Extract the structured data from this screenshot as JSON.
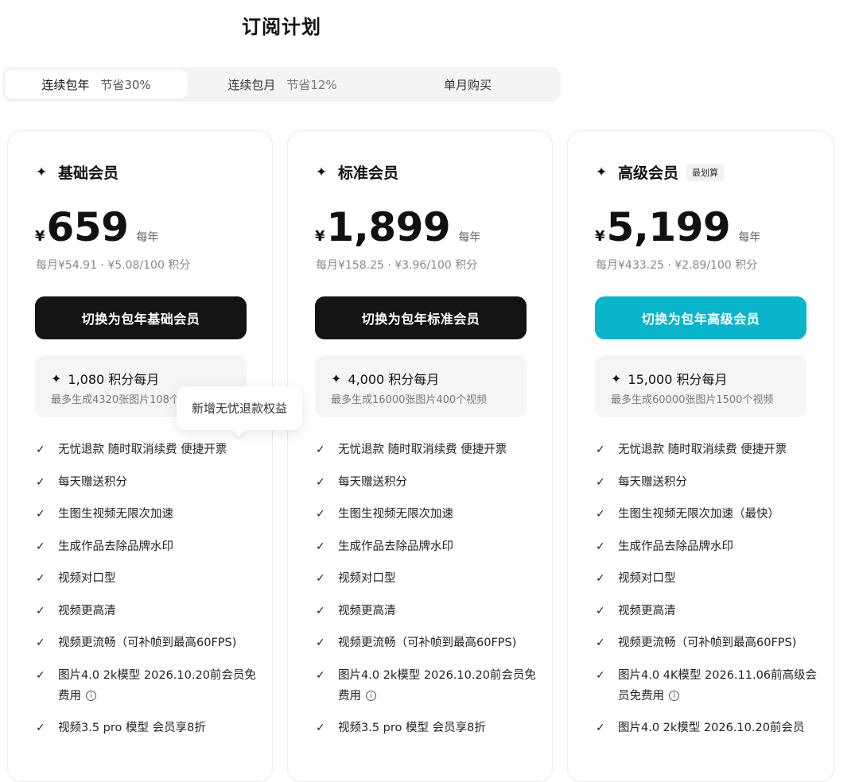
{
  "page_title": "订阅计划",
  "tabs": [
    {
      "label": "连续包年",
      "save": "节省30%"
    },
    {
      "label": "连续包月",
      "save": "节省12%"
    },
    {
      "label": "单月购买",
      "save": ""
    }
  ],
  "plans": [
    {
      "name": "基础会员",
      "badge": "",
      "icon": "sparkle-icon",
      "currency": "¥",
      "price": "659",
      "period": "每年",
      "sub_price": "每月¥54.91 · ¥5.08/100 积分",
      "cta": "切换为包年基础会员",
      "credits": "1,080 积分每月",
      "credits_desc": "最多生成4320张图片108个视频",
      "features": [
        "无忧退款  随时取消续费  便捷开票",
        "每天赠送积分",
        "生图生视频无限次加速",
        "生成作品去除品牌水印",
        "视频对口型",
        "视频更高清",
        "视频更流畅（可补帧到最高60FPS)",
        "图片4.0 2k模型 2026.10.20前会员免费用",
        "视频3.5 pro 模型 会员享8折"
      ]
    },
    {
      "name": "标准会员",
      "badge": "",
      "icon": "sparkles-icon",
      "currency": "¥",
      "price": "1,899",
      "period": "每年",
      "sub_price": "每月¥158.25 · ¥3.96/100 积分",
      "cta": "切换为包年标准会员",
      "credits": "4,000 积分每月",
      "credits_desc": "最多生成16000张图片400个视频",
      "features": [
        "无忧退款  随时取消续费  便捷开票",
        "每天赠送积分",
        "生图生视频无限次加速",
        "生成作品去除品牌水印",
        "视频对口型",
        "视频更高清",
        "视频更流畅（可补帧到最高60FPS)",
        "图片4.0 2k模型 2026.10.20前会员免费用",
        "视频3.5 pro 模型 会员享8折"
      ]
    },
    {
      "name": "高级会员",
      "badge": "最划算",
      "icon": "sparkles-multi-icon",
      "currency": "¥",
      "price": "5,199",
      "period": "每年",
      "sub_price": "每月¥433.25 · ¥2.89/100 积分",
      "cta": "切换为包年高级会员",
      "credits": "15,000 积分每月",
      "credits_desc": "最多生成60000张图片1500个视频",
      "features": [
        "无忧退款  随时取消续费  便捷开票",
        "每天赠送积分",
        "生图生视频无限次加速（最快）",
        "生成作品去除品牌水印",
        "视频对口型",
        "视频更高清",
        "视频更流畅（可补帧到最高60FPS)",
        "图片4.0 4K模型 2026.11.06前高级会员免费用",
        "图片4.0 2k模型 2026.10.20前会员"
      ]
    }
  ],
  "tooltip": "新增无忧退款权益",
  "colors": {
    "cta_dark": "#141414",
    "cta_accent": "#08b5cb",
    "card_border": "#ececec",
    "muted_text": "#888888"
  }
}
